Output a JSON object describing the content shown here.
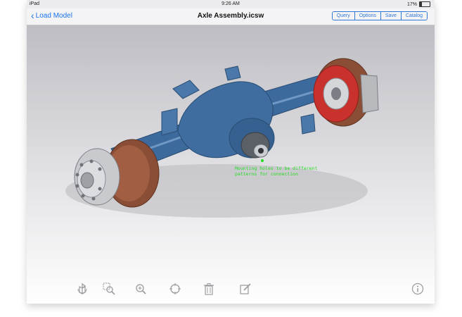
{
  "status": {
    "carrier": "iPad",
    "time": "9:26 AM",
    "battery": "17%"
  },
  "nav": {
    "back_label": "Load Model",
    "title": "Axle Assembly.icsw",
    "buttons": [
      "Query",
      "Options",
      "Save",
      "Catalog"
    ]
  },
  "annotation": {
    "line1": "Mounting holes to be different",
    "line2": "patterns for connection"
  },
  "toolbar": {
    "icons": [
      "rotate-icon",
      "zoom-window-icon",
      "zoom-icon",
      "center-icon",
      "trash-icon",
      "edit-icon",
      "info-icon"
    ]
  },
  "colors": {
    "accent": "#1a73e8",
    "annotation": "#22dd22",
    "housing": "#3d6a9c",
    "drum": "#8a4e36",
    "hub_red": "#c8312c"
  }
}
